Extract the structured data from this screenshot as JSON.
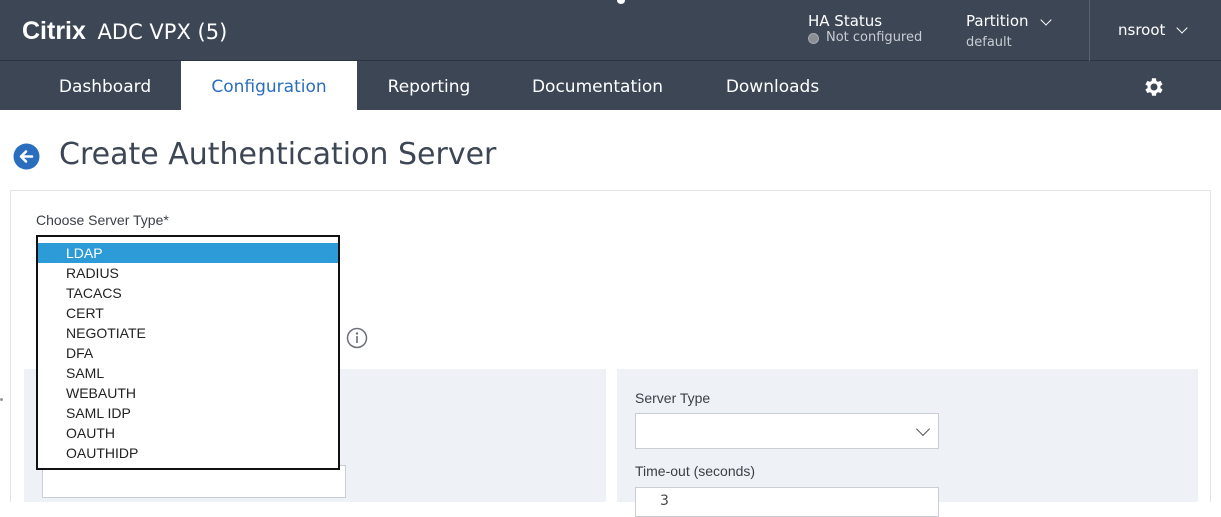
{
  "header": {
    "brand": "Citrix",
    "model": "ADC VPX (5)",
    "ha_title": "HA Status",
    "ha_status": "Not configured",
    "partition_title": "Partition",
    "partition_value": "default",
    "user": "nsroot"
  },
  "nav": {
    "tabs": [
      "Dashboard",
      "Configuration",
      "Reporting",
      "Documentation",
      "Downloads"
    ],
    "active": "Configuration"
  },
  "page": {
    "title": "Create Authentication Server"
  },
  "form": {
    "choose_server_type_label": "Choose Server Type*",
    "server_type_label": "Server Type",
    "server_type_value": "",
    "timeout_label": "Time-out (seconds)",
    "timeout_value": "3"
  },
  "dropdown": {
    "options": [
      "LDAP",
      "RADIUS",
      "TACACS",
      "CERT",
      "NEGOTIATE",
      "DFA",
      "SAML",
      "WEBAUTH",
      "SAML IDP",
      "OAUTH",
      "OAUTHIDP"
    ],
    "selected": "LDAP"
  },
  "icons": {
    "back": "back-arrow-icon",
    "gear": "gear-icon",
    "info": "info-icon",
    "chevron": "chevron-down-icon",
    "status_dot": "status-dot-icon"
  },
  "colors": {
    "header_bg": "#3d4654",
    "accent": "#2a6ebd",
    "selected_option": "#2e9bd9"
  }
}
